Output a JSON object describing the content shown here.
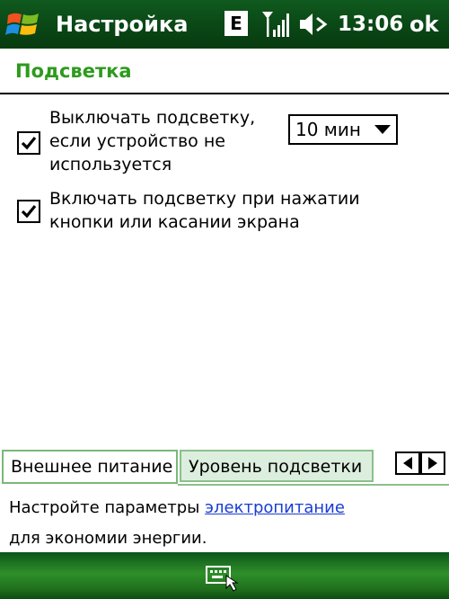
{
  "titlebar": {
    "title": "Настройка",
    "edge_label": "E",
    "time": "13:06",
    "ok_label": "ok",
    "icons": {
      "start": "windows-start-icon",
      "signal": "signal-strength-icon",
      "speaker": "speaker-muted-icon"
    }
  },
  "page": {
    "heading": "Подсветка"
  },
  "options": {
    "turn_off": {
      "line1": "Выключать подсветку,",
      "line2": "если устройство не",
      "line3": "используется",
      "checked": true
    },
    "turn_on": {
      "line1": "Включать подсветку при нажатии",
      "line2": "кнопки или касании экрана",
      "checked": true
    },
    "timeout": {
      "value": "10 мин"
    }
  },
  "tabs": [
    {
      "label": "Внешнее питание",
      "active": true
    },
    {
      "label": "Уровень подсветки",
      "active": false
    }
  ],
  "footer": {
    "text_before_link": "Настройте параметры ",
    "link_text": "электропитание",
    "line2": "для экономии энергии."
  },
  "softbar": {
    "keyboard_icon": "input-panel-icon"
  },
  "colors": {
    "titlebar": "#0b4a17",
    "heading": "#2e9a1e",
    "link": "#1a3cd6",
    "tab_inactive_bg": "#dceedd",
    "tab_border": "#8cbf8c"
  }
}
